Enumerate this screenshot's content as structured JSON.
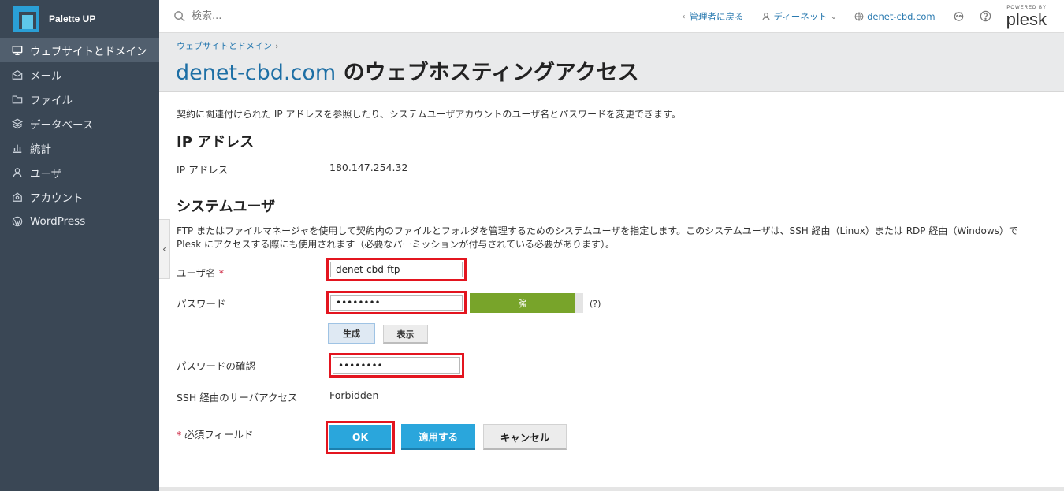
{
  "brand": {
    "name": "Palette UP"
  },
  "sidebar": {
    "items": [
      {
        "label": "ウェブサイトとドメイン",
        "icon": "monitor-icon",
        "active": true
      },
      {
        "label": "メール",
        "icon": "mail-icon"
      },
      {
        "label": "ファイル",
        "icon": "folder-icon"
      },
      {
        "label": "データベース",
        "icon": "database-icon"
      },
      {
        "label": "統計",
        "icon": "bar-chart-icon"
      },
      {
        "label": "ユーザ",
        "icon": "user-icon"
      },
      {
        "label": "アカウント",
        "icon": "account-icon"
      },
      {
        "label": "WordPress",
        "icon": "wordpress-icon"
      }
    ]
  },
  "topbar": {
    "search_placeholder": "検索...",
    "back_label": "管理者に戻る",
    "user_label": "ディーネット",
    "domain_label": "denet-cbd.com",
    "powered_by": "POWERED BY",
    "plesk": "plesk"
  },
  "header": {
    "breadcrumb": "ウェブサイトとドメイン",
    "title_domain": "denet-cbd.com",
    "title_rest": " のウェブホスティングアクセス"
  },
  "content": {
    "description": "契約に関連付けられた IP アドレスを参照したり、システムユーザアカウントのユーザ名とパスワードを変更できます。",
    "ip_heading": "IP アドレス",
    "ip_label": "IP アドレス",
    "ip_value": "180.147.254.32",
    "sysuser_heading": "システムユーザ",
    "sysuser_desc": "FTP またはファイルマネージャを使用して契約内のファイルとフォルダを管理するためのシステムユーザを指定します。このシステムユーザは、SSH 経由（Linux）または RDP 経由（Windows）で Plesk にアクセスする際にも使用されます（必要なパーミッションが付与されている必要があります）。",
    "username_label": "ユーザ名",
    "username_value": "denet-cbd-ftp",
    "password_label": "パスワード",
    "password_value": "••••••••",
    "strength_label": "強",
    "strength_help": "(?)",
    "generate_label": "生成",
    "show_label": "表示",
    "confirm_label": "パスワードの確認",
    "confirm_value": "••••••••",
    "ssh_label": "SSH 経由のサーバアクセス",
    "ssh_value": "Forbidden",
    "required_note": "必須フィールド",
    "required_mark": "*"
  },
  "buttons": {
    "ok": "OK",
    "apply": "適用する",
    "cancel": "キャンセル"
  }
}
